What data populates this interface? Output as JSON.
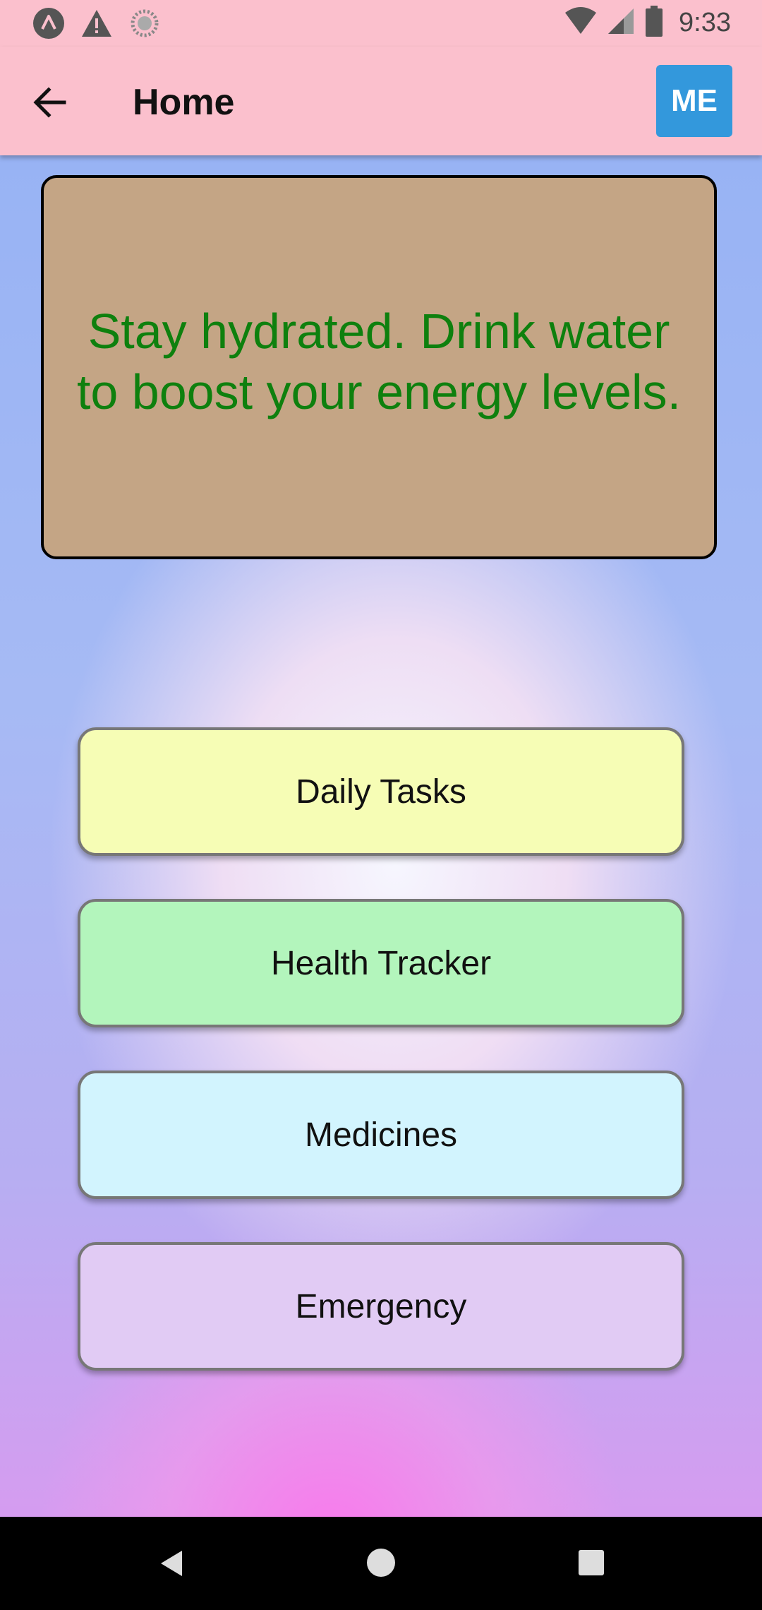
{
  "status_bar": {
    "time": "9:33",
    "left_icons": [
      "app-logo-icon",
      "warning-icon",
      "sync-icon"
    ],
    "right_icons": [
      "wifi-icon",
      "signal-icon",
      "battery-icon"
    ]
  },
  "app_bar": {
    "title": "Home",
    "back_icon": "arrow-left-icon",
    "profile_button_label": "ME",
    "background_color": "#fbc0cd",
    "profile_button_color": "#3398dc"
  },
  "tip_card": {
    "text": "Stay hydrated. Drink water to boost your energy levels.",
    "background_color": "#c4a585",
    "text_color": "#0e800e"
  },
  "menu": {
    "items": [
      {
        "label": "Daily Tasks",
        "color": "#f6fdb5"
      },
      {
        "label": "Health Tracker",
        "color": "#b3f5bc"
      },
      {
        "label": "Medicines",
        "color": "#d2f4fe"
      },
      {
        "label": "Emergency",
        "color": "#e1cbf4"
      }
    ]
  },
  "nav_bar": {
    "icons": [
      "nav-back-icon",
      "nav-home-icon",
      "nav-recents-icon"
    ]
  }
}
